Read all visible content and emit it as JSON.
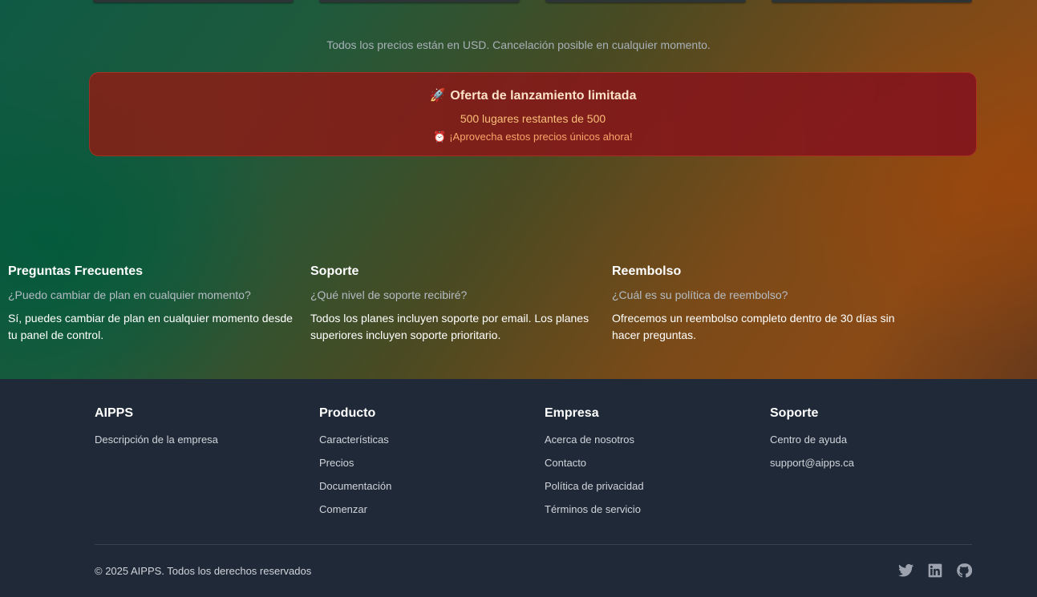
{
  "pricing": {
    "note": "Todos los precios están en USD. Cancelación posible en cualquier momento."
  },
  "offer": {
    "icon": "rocket-icon",
    "title": "Oferta de lanzamiento limitada",
    "spots": "500 lugares restantes de 500",
    "cta_icon": "alarm-clock-icon",
    "cta": "¡Aprovecha estos precios únicos ahora!"
  },
  "faq": [
    {
      "heading": "Preguntas Frecuentes",
      "question": "¿Puedo cambiar de plan en cualquier momento?",
      "answer": "Sí, puedes cambiar de plan en cualquier momento desde tu panel de control."
    },
    {
      "heading": "Soporte",
      "question": "¿Qué nivel de soporte recibiré?",
      "answer": "Todos los planes incluyen soporte por email. Los planes superiores incluyen soporte prioritario."
    },
    {
      "heading": "Reembolso",
      "question": "¿Cuál es su política de reembolso?",
      "answer": "Ofrecemos un reembolso completo dentro de 30 días sin hacer preguntas."
    }
  ],
  "footer": {
    "brand": {
      "title": "AIPPS",
      "description": "Descripción de la empresa"
    },
    "product": {
      "title": "Producto",
      "links": [
        "Características",
        "Precios",
        "Documentación",
        "Comenzar"
      ]
    },
    "company": {
      "title": "Empresa",
      "links": [
        "Acerca de nosotros",
        "Contacto",
        "Política de privacidad",
        "Términos de servicio"
      ]
    },
    "support": {
      "title": "Soporte",
      "links": [
        "Centro de ayuda",
        "support@aipps.ca"
      ]
    },
    "copyright": "© 2025 AIPPS. Todos los derechos reservados",
    "social": [
      "twitter-icon",
      "linkedin-icon",
      "github-icon"
    ]
  },
  "colors": {
    "footer_bg": "#1f2937",
    "offer_bg": "#8a1e1e",
    "offer_text": "#fcbf7a"
  }
}
